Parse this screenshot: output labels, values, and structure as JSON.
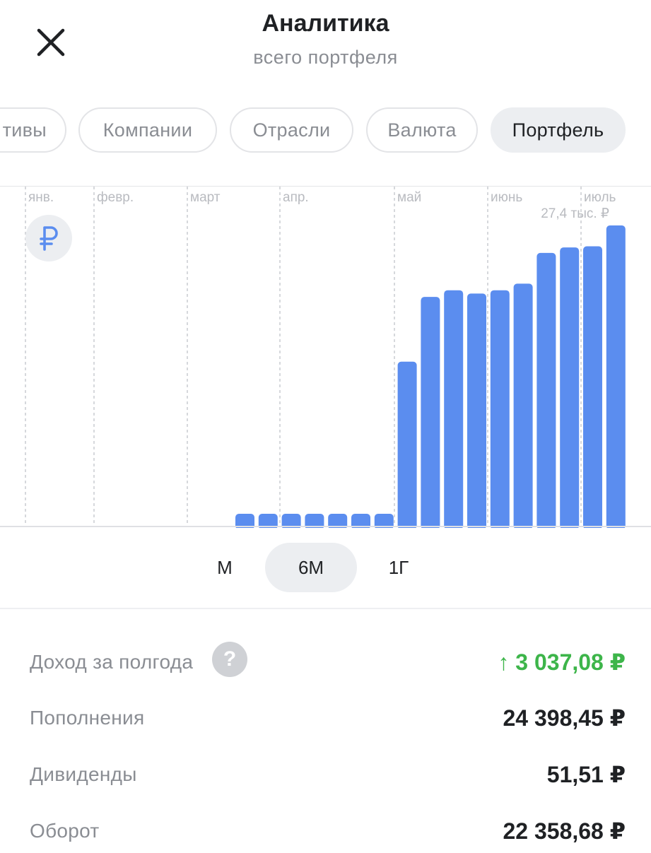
{
  "header": {
    "title": "Аналитика",
    "subtitle": "всего портфеля"
  },
  "tabs": [
    {
      "label": "тивы",
      "active": false
    },
    {
      "label": "Компании",
      "active": false
    },
    {
      "label": "Отрасли",
      "active": false
    },
    {
      "label": "Валюта",
      "active": false
    },
    {
      "label": "Портфель",
      "active": true
    }
  ],
  "chart_data": {
    "type": "bar",
    "months": [
      "янв.",
      "февр.",
      "март",
      "апр.",
      "май",
      "июнь",
      "июль"
    ],
    "max_label": "27,4 тыс. ₽",
    "currency_symbol": "₽",
    "bar_color": "#5b8def",
    "ylim": [
      0,
      27400
    ],
    "values": [
      0,
      0,
      0,
      0,
      0,
      0,
      0,
      0,
      0,
      1000,
      1000,
      1000,
      1000,
      1000,
      1000,
      1000,
      15000,
      20900,
      21500,
      21200,
      21500,
      22100,
      24900,
      25400,
      25500,
      27400
    ]
  },
  "periods": [
    {
      "label": "М",
      "active": false
    },
    {
      "label": "6М",
      "active": true
    },
    {
      "label": "1Г",
      "active": false
    }
  ],
  "stats": [
    {
      "label": "Доход за полгода",
      "value": "↑ 3 037,08 ₽",
      "accent": "#3db54a",
      "help": "?"
    },
    {
      "label": "Пополнения",
      "value": "24 398,45 ₽"
    },
    {
      "label": "Дивиденды",
      "value": "51,51 ₽"
    },
    {
      "label": "Оборот",
      "value": "22 358,68 ₽"
    }
  ]
}
